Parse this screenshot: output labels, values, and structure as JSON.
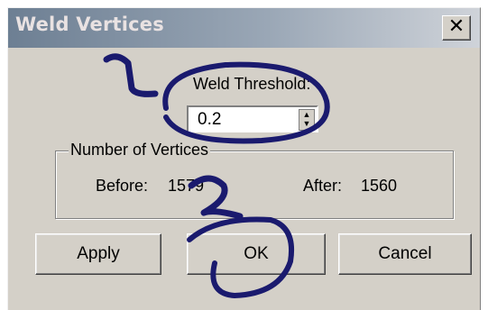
{
  "dialog": {
    "title": "Weld Vertices",
    "close_glyph": "✕"
  },
  "threshold": {
    "label": "Weld Threshold:",
    "value": "0.2"
  },
  "vertices": {
    "legend": "Number of Vertices",
    "before_label": "Before:",
    "before_value": "1579",
    "after_label": "After:",
    "after_value": "1560"
  },
  "buttons": {
    "apply": "Apply",
    "ok": "OK",
    "cancel": "Cancel"
  },
  "annotations": {
    "marker_1": "1",
    "marker_2": "2",
    "ink_color": "#1a1a6e"
  },
  "colors": {
    "dialog_bg": "#d4d0c8",
    "titlebar": "#6d7f93"
  }
}
